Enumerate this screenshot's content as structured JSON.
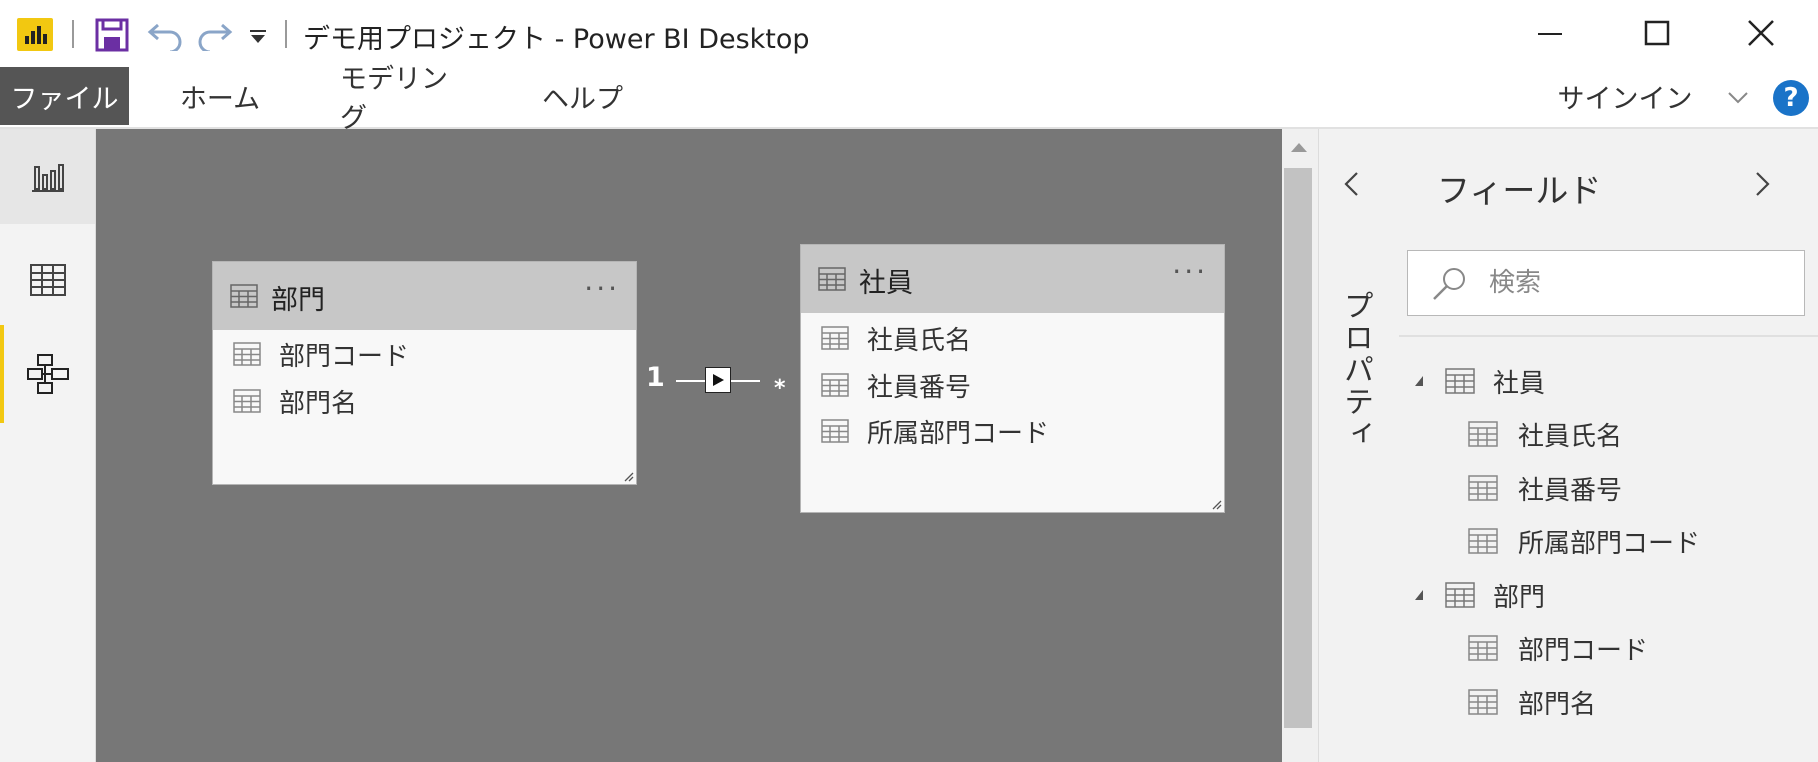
{
  "titlebar": {
    "title": "デモ用プロジェクト - Power BI Desktop"
  },
  "menu": {
    "file": "ファイル",
    "home": "ホーム",
    "modeling": "モデリング",
    "help": "ヘルプ",
    "signin": "サインイン"
  },
  "model": {
    "tables": [
      {
        "name": "部門",
        "fields": [
          "部門コード",
          "部門名"
        ]
      },
      {
        "name": "社員",
        "fields": [
          "社員氏名",
          "社員番号",
          "所属部門コード"
        ]
      }
    ],
    "relationship": {
      "from_cardinality": "1",
      "to_cardinality": "*"
    }
  },
  "properties": {
    "label": "プロパティ"
  },
  "fields_pane": {
    "title": "フィールド",
    "search_placeholder": "検索",
    "tables": [
      {
        "name": "社員",
        "fields": [
          "社員氏名",
          "社員番号",
          "所属部門コード"
        ]
      },
      {
        "name": "部門",
        "fields": [
          "部門コード",
          "部門名"
        ]
      }
    ]
  },
  "colors": {
    "accent": "#f2c811",
    "canvas": "#777777",
    "help": "#1a73c8",
    "save_icon": "#6b2fa3"
  },
  "icons": {
    "app": "power-bi-logo",
    "save": "floppy-disk-icon",
    "undo": "undo-icon",
    "redo": "redo-icon",
    "customize": "quick-access-dropdown-icon",
    "report_view": "bar-chart-icon",
    "data_view": "grid-icon",
    "model_view": "model-icon"
  }
}
